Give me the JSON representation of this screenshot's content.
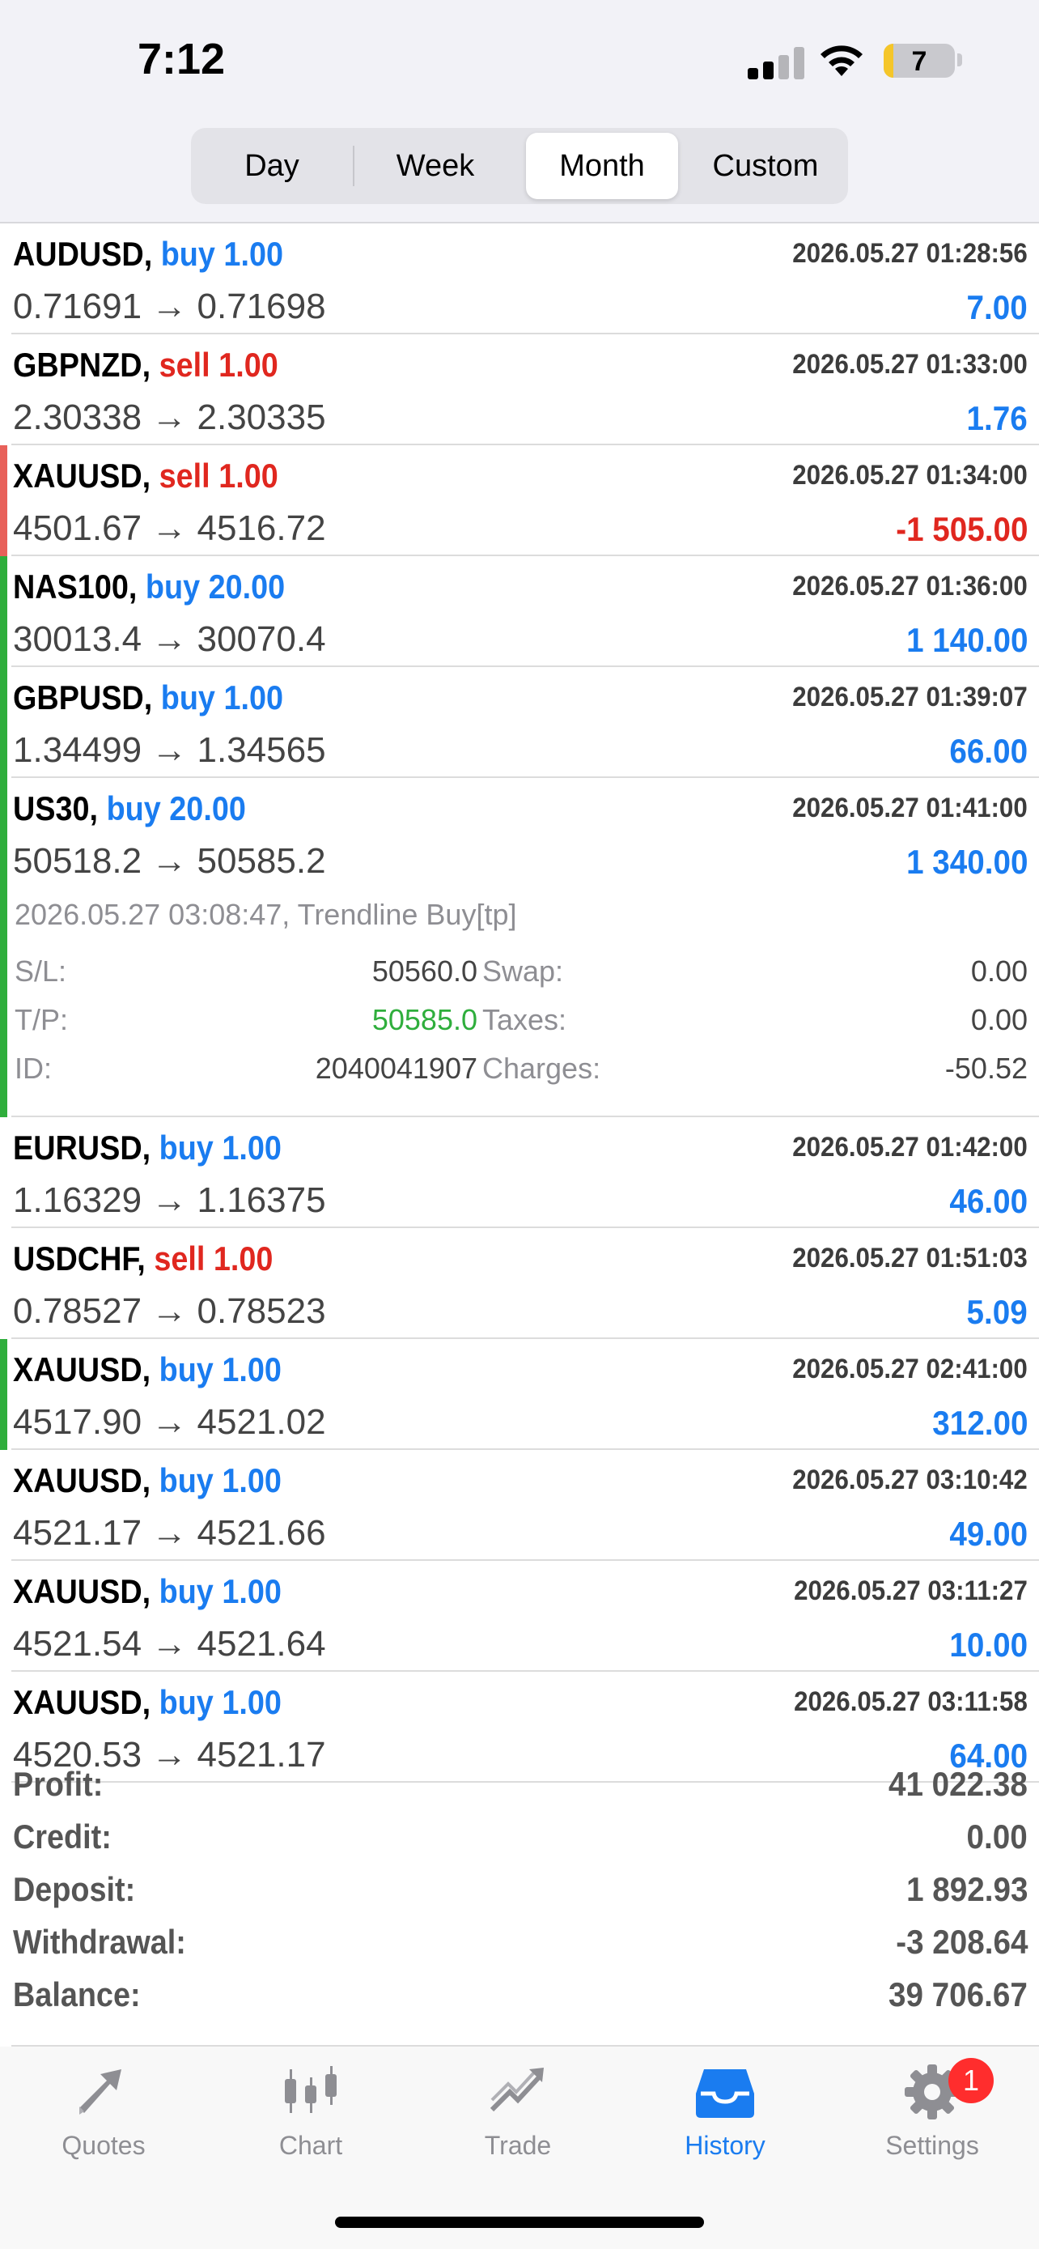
{
  "status": {
    "time": "7:12",
    "battery": "7"
  },
  "segments": [
    "Day",
    "Week",
    "Month",
    "Custom"
  ],
  "active_segment": "Month",
  "colors": {
    "buy": "#1a7cf0",
    "sell": "#e0271f",
    "win_bar": "#2fae3c",
    "loss_bar": "#e8615a",
    "tp": "#2fae3c"
  },
  "trades": [
    {
      "symbol": "AUDUSD,",
      "side": "buy",
      "volume": "1.00",
      "time": "2026.05.27 01:28:56",
      "open": "0.71691",
      "close": "0.71698",
      "profit": "7.00",
      "bar": "none"
    },
    {
      "symbol": "GBPNZD,",
      "side": "sell",
      "volume": "1.00",
      "time": "2026.05.27 01:33:00",
      "open": "2.30338",
      "close": "2.30335",
      "profit": "1.76",
      "bar": "none"
    },
    {
      "symbol": "XAUUSD,",
      "side": "sell",
      "volume": "1.00",
      "time": "2026.05.27 01:34:00",
      "open": "4501.67",
      "close": "4516.72",
      "profit": "-1 505.00",
      "bar": "loss"
    },
    {
      "symbol": "NAS100,",
      "side": "buy",
      "volume": "20.00",
      "time": "2026.05.27 01:36:00",
      "open": "30013.4",
      "close": "30070.4",
      "profit": "1 140.00",
      "bar": "win"
    },
    {
      "symbol": "GBPUSD,",
      "side": "buy",
      "volume": "1.00",
      "time": "2026.05.27 01:39:07",
      "open": "1.34499",
      "close": "1.34565",
      "profit": "66.00",
      "bar": "win"
    },
    {
      "symbol": "US30,",
      "side": "buy",
      "volume": "20.00",
      "time": "2026.05.27 01:41:00",
      "open": "50518.2",
      "close": "50585.2",
      "profit": "1 340.00",
      "bar": "win",
      "expanded": true,
      "comment": "2026.05.27 03:08:47, Trendline Buy[tp]",
      "details": {
        "sl_label": "S/L:",
        "sl": "50560.0",
        "tp_label": "T/P:",
        "tp": "50585.0",
        "id_label": "ID:",
        "id": "2040041907",
        "swap_label": "Swap:",
        "swap": "0.00",
        "taxes_label": "Taxes:",
        "taxes": "0.00",
        "charges_label": "Charges:",
        "charges": "-50.52"
      }
    },
    {
      "symbol": "EURUSD,",
      "side": "buy",
      "volume": "1.00",
      "time": "2026.05.27 01:42:00",
      "open": "1.16329",
      "close": "1.16375",
      "profit": "46.00",
      "bar": "none"
    },
    {
      "symbol": "USDCHF,",
      "side": "sell",
      "volume": "1.00",
      "time": "2026.05.27 01:51:03",
      "open": "0.78527",
      "close": "0.78523",
      "profit": "5.09",
      "bar": "none"
    },
    {
      "symbol": "XAUUSD,",
      "side": "buy",
      "volume": "1.00",
      "time": "2026.05.27 02:41:00",
      "open": "4517.90",
      "close": "4521.02",
      "profit": "312.00",
      "bar": "win"
    },
    {
      "symbol": "XAUUSD,",
      "side": "buy",
      "volume": "1.00",
      "time": "2026.05.27 03:10:42",
      "open": "4521.17",
      "close": "4521.66",
      "profit": "49.00",
      "bar": "none"
    },
    {
      "symbol": "XAUUSD,",
      "side": "buy",
      "volume": "1.00",
      "time": "2026.05.27 03:11:27",
      "open": "4521.54",
      "close": "4521.64",
      "profit": "10.00",
      "bar": "none"
    },
    {
      "symbol": "XAUUSD,",
      "side": "buy",
      "volume": "1.00",
      "time": "2026.05.27 03:11:58",
      "open": "4520.53",
      "close": "4521.17",
      "profit": "64.00",
      "bar": "none"
    }
  ],
  "summary": [
    {
      "label": "Profit:",
      "value": "41 022.38"
    },
    {
      "label": "Credit:",
      "value": "0.00"
    },
    {
      "label": "Deposit:",
      "value": "1 892.93"
    },
    {
      "label": "Withdrawal:",
      "value": "-3 208.64"
    },
    {
      "label": "Balance:",
      "value": "39 706.67"
    }
  ],
  "tabs": [
    {
      "label": "Quotes",
      "icon": "quotes-icon"
    },
    {
      "label": "Chart",
      "icon": "chart-icon"
    },
    {
      "label": "Trade",
      "icon": "trade-icon"
    },
    {
      "label": "History",
      "icon": "history-icon",
      "active": true
    },
    {
      "label": "Settings",
      "icon": "settings-icon",
      "badge": "1"
    }
  ]
}
